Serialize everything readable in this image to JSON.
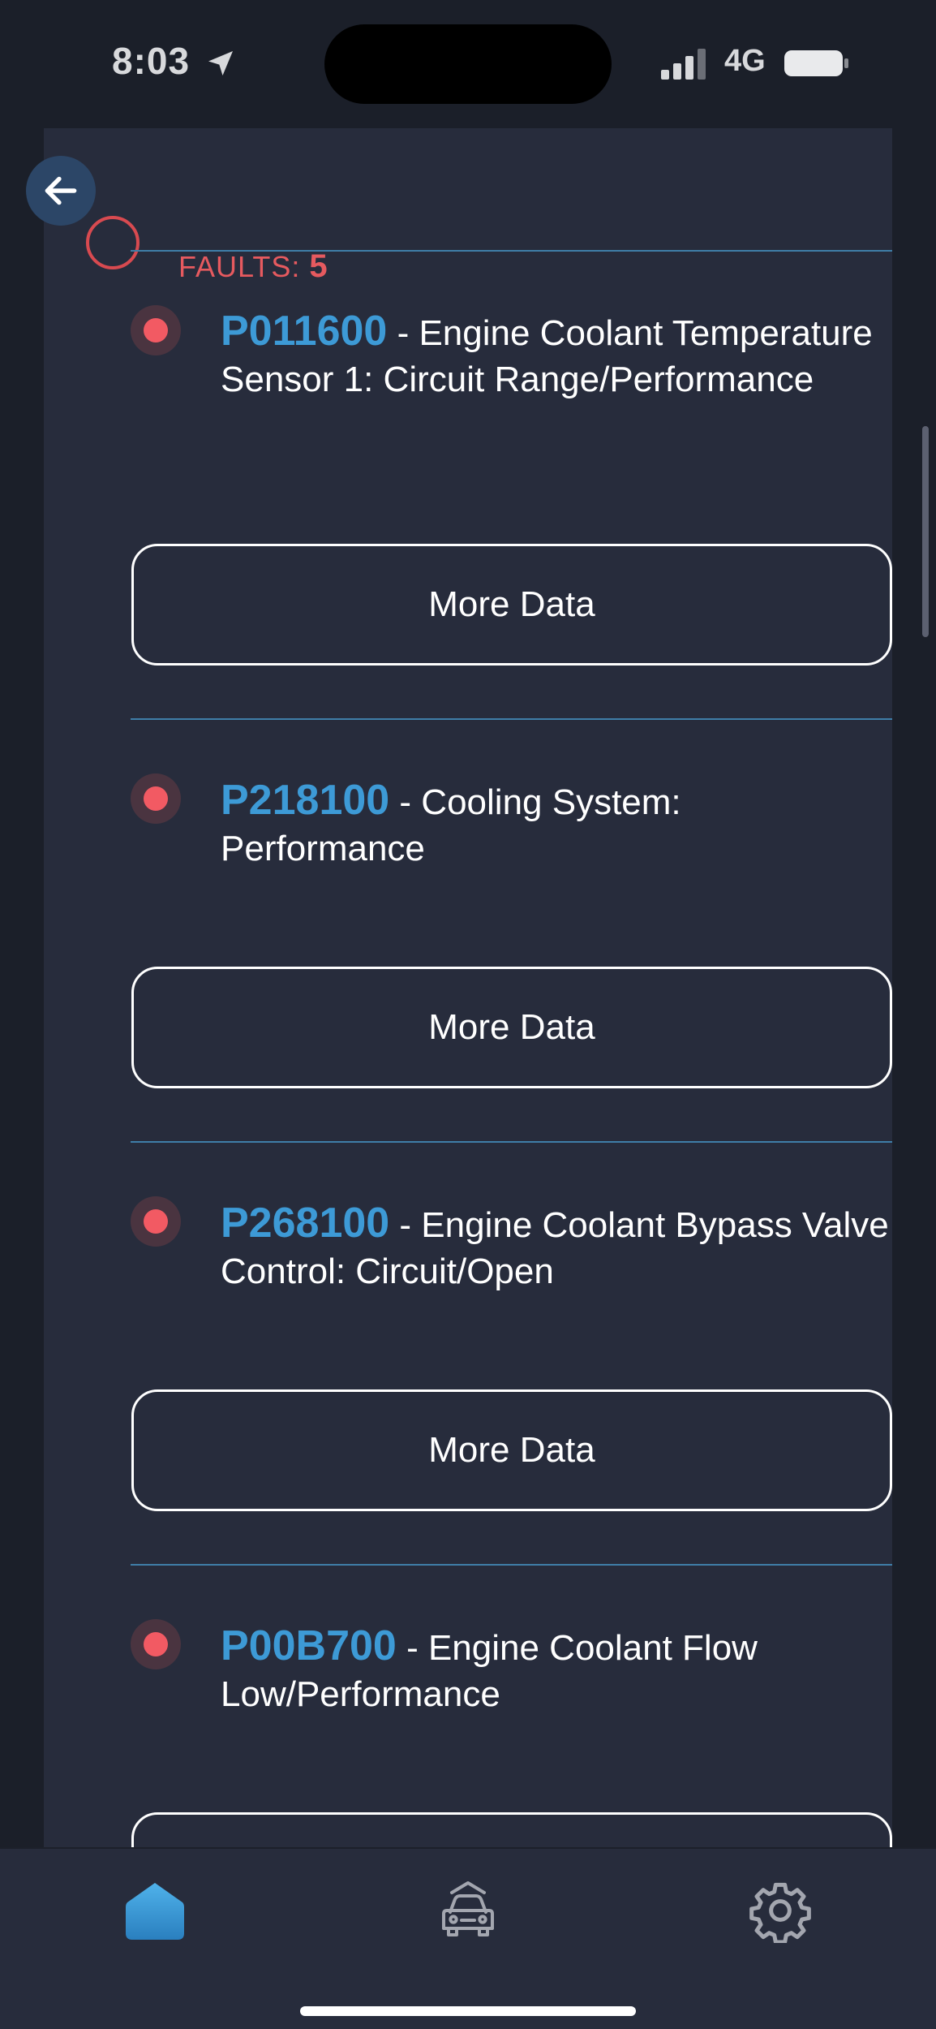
{
  "status_bar": {
    "time": "8:03",
    "network": "4G",
    "icons": [
      "location-arrow-icon",
      "signal-icon",
      "battery-icon"
    ]
  },
  "header": {
    "faults_label": "FAULTS:",
    "faults_count": "5",
    "back_icon": "arrow-left-icon"
  },
  "faults": [
    {
      "code": "P011600",
      "description": " - Engine Coolant Temperature Sensor 1: Circuit Range/Performance",
      "button_label": "More Data"
    },
    {
      "code": "P218100",
      "description": " - Cooling System: Performance",
      "button_label": "More Data"
    },
    {
      "code": "P268100",
      "description": " - Engine Coolant Bypass Valve Control: Circuit/Open",
      "button_label": "More Data"
    },
    {
      "code": "P00B700",
      "description": " - Engine Coolant Flow Low/Performance",
      "button_label": ""
    }
  ],
  "tab_bar": {
    "tabs": [
      {
        "icon": "home-icon",
        "active": true
      },
      {
        "icon": "car-icon",
        "active": false
      },
      {
        "icon": "gear-icon",
        "active": false
      }
    ]
  },
  "colors": {
    "background": "#1b1f29",
    "card": "#272c3c",
    "code_blue": "#3d9ad6",
    "fault_red": "#f25a63",
    "divider": "#3f7ea8"
  }
}
